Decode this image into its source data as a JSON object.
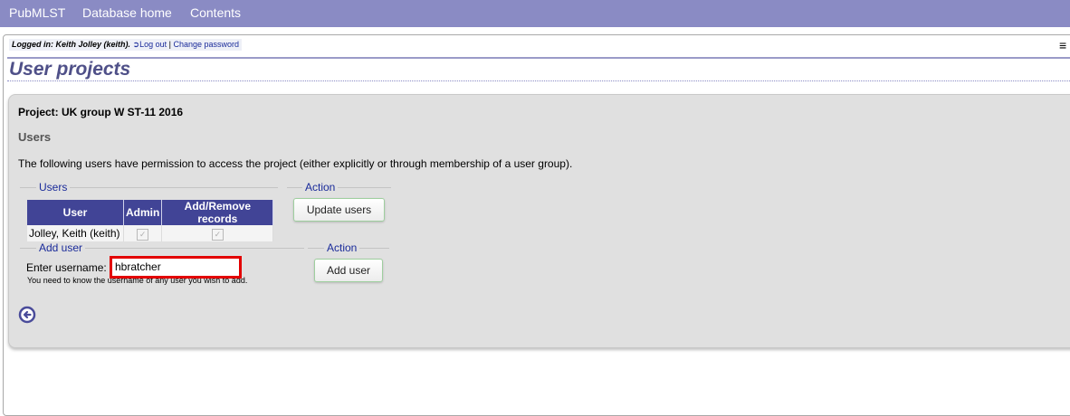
{
  "nav": {
    "links": [
      "PubMLST",
      "Database home",
      "Contents"
    ]
  },
  "login": {
    "prefix": "Logged in: ",
    "user": "Keith Jolley (keith).",
    "logout": "Log out",
    "sep": " | ",
    "change_password": "Change password"
  },
  "menu_icon": "≡",
  "page": {
    "title": "User projects"
  },
  "project": {
    "title": "Project: UK group W ST-11 2016",
    "users_heading": "Users",
    "description": "The following users have permission to access the project (either explicitly or through membership of a user group)."
  },
  "users_fieldset": {
    "legend": "Users",
    "columns": [
      "User",
      "Admin",
      "Add/Remove records"
    ],
    "rows": [
      {
        "user": "Jolley, Keith (keith)",
        "admin": true,
        "modify": true
      }
    ]
  },
  "action_legend": "Action",
  "update_button": "Update users",
  "add_user": {
    "legend": "Add user",
    "label": "Enter username:",
    "value": "hbratcher",
    "note": "You need to know the username of any user you wish to add.",
    "button": "Add user"
  },
  "icons": {
    "back": "back-arrow-icon",
    "logout": "logout-icon",
    "menu": "hamburger-menu-icon"
  },
  "colors": {
    "nav_bg": "#8a8bc4",
    "table_header": "#414496",
    "title": "#4f5088",
    "highlight": "#e30000"
  }
}
